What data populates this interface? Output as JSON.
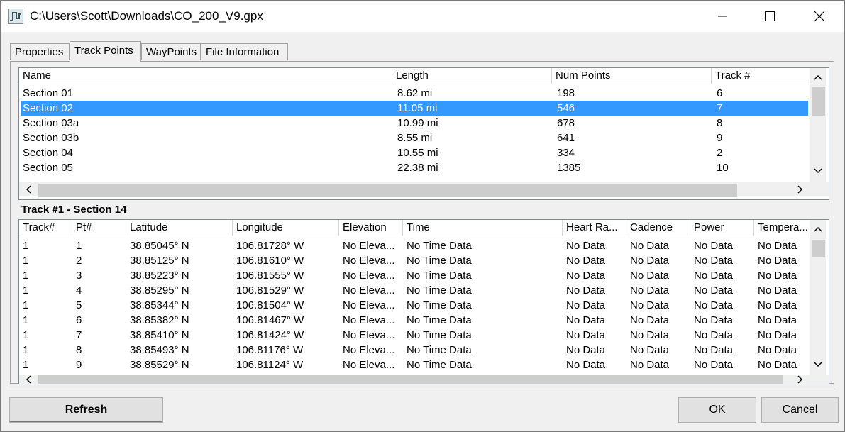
{
  "window": {
    "title": "C:\\Users\\Scott\\Downloads\\CO_200_V9.gpx"
  },
  "tabs": [
    "Properties",
    "Track Points",
    "WayPoints",
    "File Information"
  ],
  "tracks": {
    "columns": [
      "Name",
      "Length",
      "Num Points",
      "Track #"
    ],
    "rows": [
      [
        "Section 01",
        "8.62 mi",
        "198",
        "6"
      ],
      [
        "Section 02",
        "11.05 mi",
        "546",
        "7"
      ],
      [
        "Section 03a",
        "10.99 mi",
        "678",
        "8"
      ],
      [
        "Section 03b",
        "8.55 mi",
        "641",
        "9"
      ],
      [
        "Section 04",
        "10.55 mi",
        "334",
        "2"
      ],
      [
        "Section 05",
        "22.38 mi",
        "1385",
        "10"
      ]
    ],
    "selected_index": 1
  },
  "points": {
    "section_title": "Track #1 - Section 14",
    "columns": [
      "Track#",
      "Pt#",
      "Latitude",
      "Longitude",
      "Elevation",
      "Time",
      "Heart Ra...",
      "Cadence",
      "Power",
      "Tempera..."
    ],
    "rows": [
      [
        "1",
        "1",
        "38.85045° N",
        "106.81728° W",
        "No Eleva...",
        "No Time Data",
        "No Data",
        "No Data",
        "No Data",
        "No Data"
      ],
      [
        "1",
        "2",
        "38.85125° N",
        "106.81610° W",
        "No Eleva...",
        "No Time Data",
        "No Data",
        "No Data",
        "No Data",
        "No Data"
      ],
      [
        "1",
        "3",
        "38.85223° N",
        "106.81555° W",
        "No Eleva...",
        "No Time Data",
        "No Data",
        "No Data",
        "No Data",
        "No Data"
      ],
      [
        "1",
        "4",
        "38.85295° N",
        "106.81529° W",
        "No Eleva...",
        "No Time Data",
        "No Data",
        "No Data",
        "No Data",
        "No Data"
      ],
      [
        "1",
        "5",
        "38.85344° N",
        "106.81504° W",
        "No Eleva...",
        "No Time Data",
        "No Data",
        "No Data",
        "No Data",
        "No Data"
      ],
      [
        "1",
        "6",
        "38.85382° N",
        "106.81467° W",
        "No Eleva...",
        "No Time Data",
        "No Data",
        "No Data",
        "No Data",
        "No Data"
      ],
      [
        "1",
        "7",
        "38.85410° N",
        "106.81424° W",
        "No Eleva...",
        "No Time Data",
        "No Data",
        "No Data",
        "No Data",
        "No Data"
      ],
      [
        "1",
        "8",
        "38.85493° N",
        "106.81176° W",
        "No Eleva...",
        "No Time Data",
        "No Data",
        "No Data",
        "No Data",
        "No Data"
      ],
      [
        "1",
        "9",
        "38.85529° N",
        "106.81124° W",
        "No Eleva...",
        "No Time Data",
        "No Data",
        "No Data",
        "No Data",
        "No Data"
      ]
    ]
  },
  "buttons": {
    "refresh": "Refresh",
    "ok": "OK",
    "cancel": "Cancel"
  },
  "colors": {
    "selection": "#3399ff",
    "window_bg": "#f0f0f0"
  },
  "icons": [
    "gpx-track-icon",
    "minimize-icon",
    "maximize-icon",
    "close-icon",
    "chevron-up-icon",
    "chevron-down-icon",
    "chevron-left-icon",
    "chevron-right-icon"
  ]
}
